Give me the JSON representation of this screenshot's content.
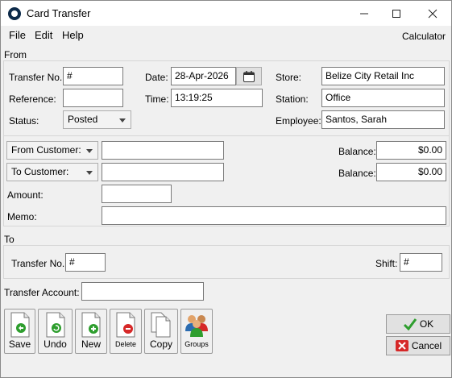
{
  "window": {
    "title": "Card Transfer"
  },
  "menu": {
    "file": "File",
    "edit": "Edit",
    "help": "Help",
    "calculator": "Calculator"
  },
  "from": {
    "section_label": "From",
    "transfer_no_label": "Transfer No.",
    "transfer_no_value": "#",
    "reference_label": "Reference:",
    "reference_value": "",
    "status_label": "Status:",
    "status_value": "Posted",
    "date_label": "Date:",
    "date_value": "28-Apr-2026",
    "time_label": "Time:",
    "time_value": "13:19:25",
    "store_label": "Store:",
    "store_value": "Belize City Retail Inc",
    "station_label": "Station:",
    "station_value": "Office",
    "employee_label": "Employee:",
    "employee_value": "Santos, Sarah",
    "from_customer_label": "From Customer:",
    "from_customer_value": "",
    "to_customer_label": "To Customer:",
    "to_customer_value": "",
    "balance_label_1": "Balance:",
    "balance_value_1": "$0.00",
    "balance_label_2": "Balance:",
    "balance_value_2": "$0.00",
    "amount_label": "Amount:",
    "amount_value": "",
    "memo_label": "Memo:",
    "memo_value": ""
  },
  "to": {
    "section_label": "To",
    "transfer_no_label": "Transfer No.",
    "transfer_no_value": "#",
    "shift_label": "Shift:",
    "shift_value": "#",
    "transfer_account_label": "Transfer Account:",
    "transfer_account_value": ""
  },
  "toolbar": {
    "save": "Save",
    "undo": "Undo",
    "new": "New",
    "delete": "Delete",
    "copy": "Copy",
    "groups": "Groups"
  },
  "actions": {
    "ok": "OK",
    "cancel": "Cancel"
  },
  "colors": {
    "green": "#2e9e2e",
    "red": "#d62828",
    "accent_blue": "#0d2b4a"
  }
}
